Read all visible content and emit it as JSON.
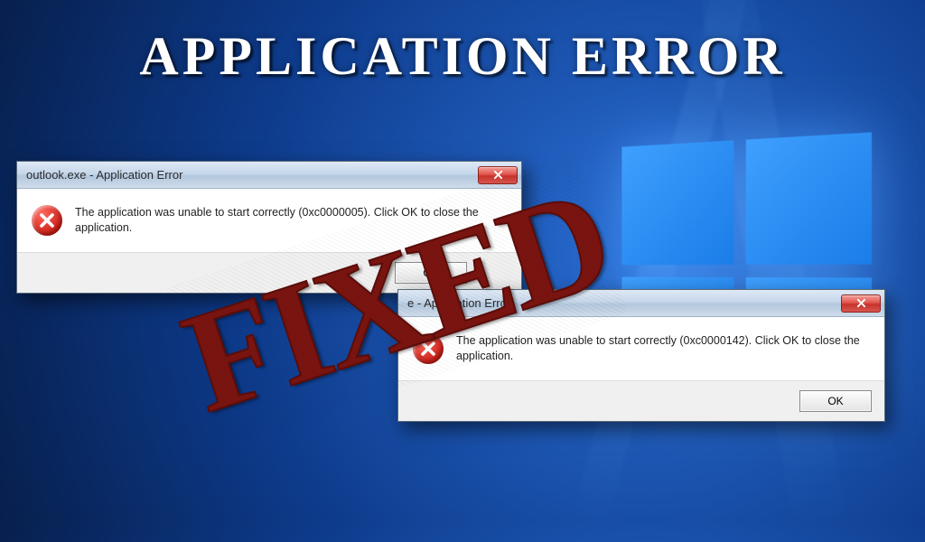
{
  "headline": "APPLICATION ERROR",
  "stamp": "FIXED",
  "dialog1": {
    "title": "outlook.exe - Application Error",
    "message": "The application was unable to start correctly (0xc0000005). Click OK to close the application.",
    "ok_label": "OK"
  },
  "dialog2": {
    "title": "e - Application Error",
    "message": "The application was unable to start correctly (0xc0000142). Click OK to close the application.",
    "ok_label": "OK"
  }
}
